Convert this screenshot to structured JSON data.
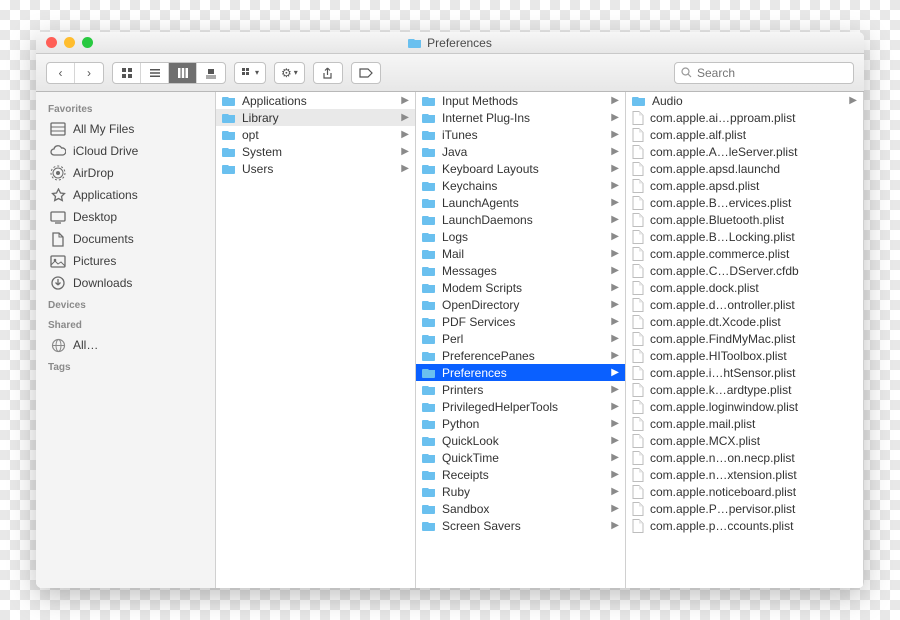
{
  "window": {
    "title": "Preferences"
  },
  "toolbar": {
    "search_placeholder": "Search"
  },
  "sidebar": {
    "sections": [
      {
        "header": "Favorites",
        "items": [
          {
            "icon": "all-my-files-icon",
            "label": "All My Files"
          },
          {
            "icon": "icloud-icon",
            "label": "iCloud Drive"
          },
          {
            "icon": "airdrop-icon",
            "label": "AirDrop"
          },
          {
            "icon": "applications-icon",
            "label": "Applications"
          },
          {
            "icon": "desktop-icon",
            "label": "Desktop"
          },
          {
            "icon": "documents-icon",
            "label": "Documents"
          },
          {
            "icon": "pictures-icon",
            "label": "Pictures"
          },
          {
            "icon": "downloads-icon",
            "label": "Downloads"
          }
        ]
      },
      {
        "header": "Devices",
        "items": []
      },
      {
        "header": "Shared",
        "items": [
          {
            "icon": "network-icon",
            "label": "All…"
          }
        ]
      },
      {
        "header": "Tags",
        "items": []
      }
    ]
  },
  "columns": [
    {
      "items": [
        {
          "label": "Applications",
          "type": "folder",
          "arrow": true
        },
        {
          "label": "Library",
          "type": "folder",
          "arrow": true,
          "dim": true
        },
        {
          "label": "opt",
          "type": "folder",
          "arrow": true
        },
        {
          "label": "System",
          "type": "folder",
          "arrow": true
        },
        {
          "label": "Users",
          "type": "folder",
          "arrow": true
        }
      ]
    },
    {
      "items": [
        {
          "label": "Input Methods",
          "type": "folder",
          "arrow": true
        },
        {
          "label": "Internet Plug-Ins",
          "type": "folder",
          "arrow": true
        },
        {
          "label": "iTunes",
          "type": "folder",
          "arrow": true
        },
        {
          "label": "Java",
          "type": "folder",
          "arrow": true
        },
        {
          "label": "Keyboard Layouts",
          "type": "folder",
          "arrow": true
        },
        {
          "label": "Keychains",
          "type": "folder",
          "arrow": true
        },
        {
          "label": "LaunchAgents",
          "type": "folder",
          "arrow": true
        },
        {
          "label": "LaunchDaemons",
          "type": "folder",
          "arrow": true
        },
        {
          "label": "Logs",
          "type": "folder",
          "arrow": true
        },
        {
          "label": "Mail",
          "type": "folder",
          "arrow": true
        },
        {
          "label": "Messages",
          "type": "folder",
          "arrow": true
        },
        {
          "label": "Modem Scripts",
          "type": "folder",
          "arrow": true
        },
        {
          "label": "OpenDirectory",
          "type": "folder",
          "arrow": true
        },
        {
          "label": "PDF Services",
          "type": "folder",
          "arrow": true
        },
        {
          "label": "Perl",
          "type": "folder",
          "arrow": true
        },
        {
          "label": "PreferencePanes",
          "type": "folder",
          "arrow": true
        },
        {
          "label": "Preferences",
          "type": "folder",
          "arrow": true,
          "selected": true
        },
        {
          "label": "Printers",
          "type": "folder",
          "arrow": true
        },
        {
          "label": "PrivilegedHelperTools",
          "type": "folder",
          "arrow": true
        },
        {
          "label": "Python",
          "type": "folder",
          "arrow": true
        },
        {
          "label": "QuickLook",
          "type": "folder",
          "arrow": true
        },
        {
          "label": "QuickTime",
          "type": "folder",
          "arrow": true
        },
        {
          "label": "Receipts",
          "type": "folder",
          "arrow": true
        },
        {
          "label": "Ruby",
          "type": "folder",
          "arrow": true
        },
        {
          "label": "Sandbox",
          "type": "folder",
          "arrow": true
        },
        {
          "label": "Screen Savers",
          "type": "folder",
          "arrow": true
        }
      ]
    },
    {
      "items": [
        {
          "label": "Audio",
          "type": "folder",
          "arrow": true
        },
        {
          "label": "com.apple.ai…pproam.plist",
          "type": "file"
        },
        {
          "label": "com.apple.alf.plist",
          "type": "file"
        },
        {
          "label": "com.apple.A…leServer.plist",
          "type": "file"
        },
        {
          "label": "com.apple.apsd.launchd",
          "type": "file"
        },
        {
          "label": "com.apple.apsd.plist",
          "type": "file"
        },
        {
          "label": "com.apple.B…ervices.plist",
          "type": "file"
        },
        {
          "label": "com.apple.Bluetooth.plist",
          "type": "file"
        },
        {
          "label": "com.apple.B…Locking.plist",
          "type": "file"
        },
        {
          "label": "com.apple.commerce.plist",
          "type": "file"
        },
        {
          "label": "com.apple.C…DServer.cfdb",
          "type": "file"
        },
        {
          "label": "com.apple.dock.plist",
          "type": "file"
        },
        {
          "label": "com.apple.d…ontroller.plist",
          "type": "file"
        },
        {
          "label": "com.apple.dt.Xcode.plist",
          "type": "file"
        },
        {
          "label": "com.apple.FindMyMac.plist",
          "type": "file"
        },
        {
          "label": "com.apple.HIToolbox.plist",
          "type": "file"
        },
        {
          "label": "com.apple.i…htSensor.plist",
          "type": "file"
        },
        {
          "label": "com.apple.k…ardtype.plist",
          "type": "file"
        },
        {
          "label": "com.apple.loginwindow.plist",
          "type": "file"
        },
        {
          "label": "com.apple.mail.plist",
          "type": "file"
        },
        {
          "label": "com.apple.MCX.plist",
          "type": "file"
        },
        {
          "label": "com.apple.n…on.necp.plist",
          "type": "file"
        },
        {
          "label": "com.apple.n…xtension.plist",
          "type": "file"
        },
        {
          "label": "com.apple.noticeboard.plist",
          "type": "file"
        },
        {
          "label": "com.apple.P…pervisor.plist",
          "type": "file"
        },
        {
          "label": "com.apple.p…ccounts.plist",
          "type": "file"
        }
      ]
    }
  ]
}
